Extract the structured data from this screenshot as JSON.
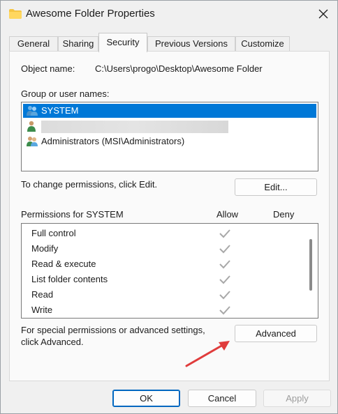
{
  "window": {
    "title": "Awesome Folder Properties",
    "title_icon": "folder-icon",
    "close_icon": "close-icon"
  },
  "tabs": [
    {
      "label": "General",
      "active": false
    },
    {
      "label": "Sharing",
      "active": false
    },
    {
      "label": "Security",
      "active": true
    },
    {
      "label": "Previous Versions",
      "active": false
    },
    {
      "label": "Customize",
      "active": false
    }
  ],
  "security": {
    "object_name_label": "Object name:",
    "object_name_value": "C:\\Users\\progo\\Desktop\\Awesome Folder",
    "group_label": "Group or user names:",
    "users": [
      {
        "name": "SYSTEM",
        "selected": true,
        "icon": "user-group-icon"
      },
      {
        "name": "",
        "selected": false,
        "icon": "user-icon",
        "redacted": true
      },
      {
        "name": "Administrators (MSI\\Administrators)",
        "selected": false,
        "icon": "user-group-icon"
      }
    ],
    "change_perm_text": "To change permissions, click Edit.",
    "edit_button": "Edit...",
    "permissions_header": "Permissions for SYSTEM",
    "allow_header": "Allow",
    "deny_header": "Deny",
    "permissions": [
      {
        "name": "Full control",
        "allow": true,
        "deny": false
      },
      {
        "name": "Modify",
        "allow": true,
        "deny": false
      },
      {
        "name": "Read & execute",
        "allow": true,
        "deny": false
      },
      {
        "name": "List folder contents",
        "allow": true,
        "deny": false
      },
      {
        "name": "Read",
        "allow": true,
        "deny": false
      },
      {
        "name": "Write",
        "allow": true,
        "deny": false
      }
    ],
    "special_text_line1": "For special permissions or advanced settings,",
    "special_text_line2": "click Advanced.",
    "advanced_button": "Advanced"
  },
  "footer": {
    "ok": "OK",
    "cancel": "Cancel",
    "apply": "Apply"
  },
  "colors": {
    "selection": "#0078d7",
    "accent_border": "#0067c0",
    "arrow": "#e03c3c",
    "check": "#a8a8a8"
  }
}
